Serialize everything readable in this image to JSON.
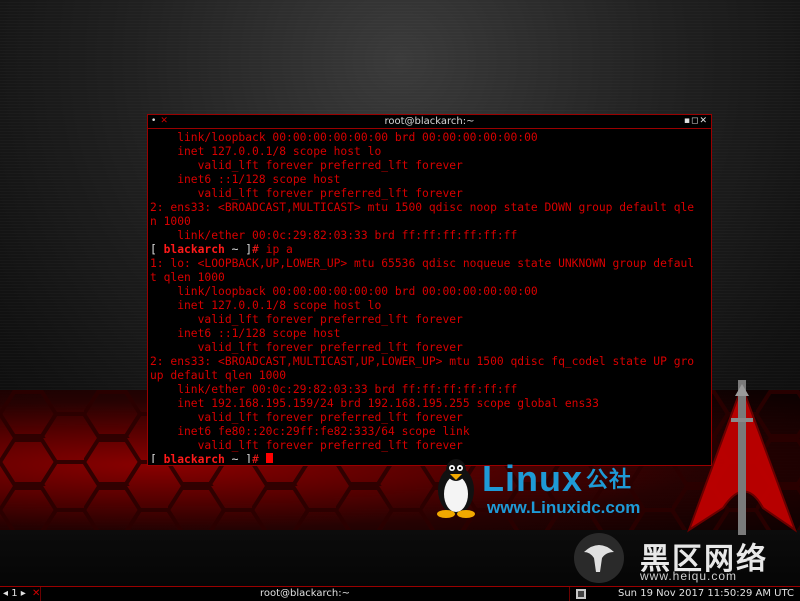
{
  "window": {
    "title": "root@blackarch:~",
    "controls": "▪◻✕",
    "menu_glyph": "•"
  },
  "terminal": {
    "prompt": {
      "open": "[ ",
      "user": "blackarch",
      "path": " ~ ",
      "close": "]",
      "hash": "# "
    },
    "lines": [
      "    link/loopback 00:00:00:00:00:00 brd 00:00:00:00:00:00",
      "    inet 127.0.0.1/8 scope host lo",
      "       valid_lft forever preferred_lft forever",
      "    inet6 ::1/128 scope host",
      "       valid_lft forever preferred_lft forever",
      "2: ens33: <BROADCAST,MULTICAST> mtu 1500 qdisc noop state DOWN group default qle",
      "n 1000",
      "    link/ether 00:0c:29:82:03:33 brd ff:ff:ff:ff:ff:ff",
      "1: lo: <LOOPBACK,UP,LOWER_UP> mtu 65536 qdisc noqueue state UNKNOWN group defaul",
      "t qlen 1000",
      "    link/loopback 00:00:00:00:00:00 brd 00:00:00:00:00:00",
      "    inet 127.0.0.1/8 scope host lo",
      "       valid_lft forever preferred_lft forever",
      "    inet6 ::1/128 scope host",
      "       valid_lft forever preferred_lft forever",
      "2: ens33: <BROADCAST,MULTICAST,UP,LOWER_UP> mtu 1500 qdisc fq_codel state UP gro",
      "up default qlen 1000",
      "    link/ether 00:0c:29:82:03:33 brd ff:ff:ff:ff:ff:ff",
      "    inet 192.168.195.159/24 brd 192.168.195.255 scope global ens33",
      "       valid_lft forever preferred_lft forever",
      "    inet6 fe80::20c:29ff:fe82:333/64 scope link",
      "       valid_lft forever preferred_lft forever"
    ],
    "command": "ip a"
  },
  "watermarks": {
    "linux_word": "Linux",
    "linux_cn": "公社",
    "linux_url": "www.Linuxidc.com",
    "heiqu_cn": "黑区网络",
    "heiqu_url": "www.heiqu.com"
  },
  "taskbar": {
    "desktop": "◂ 1 ▸",
    "close_glyph": "✕",
    "task_title": "root@blackarch:~",
    "clock": "Sun 19 Nov 2017 11:50:29 AM UTC"
  },
  "colors": {
    "accent_red": "#d80000",
    "linux_blue": "#1e9ad6"
  }
}
